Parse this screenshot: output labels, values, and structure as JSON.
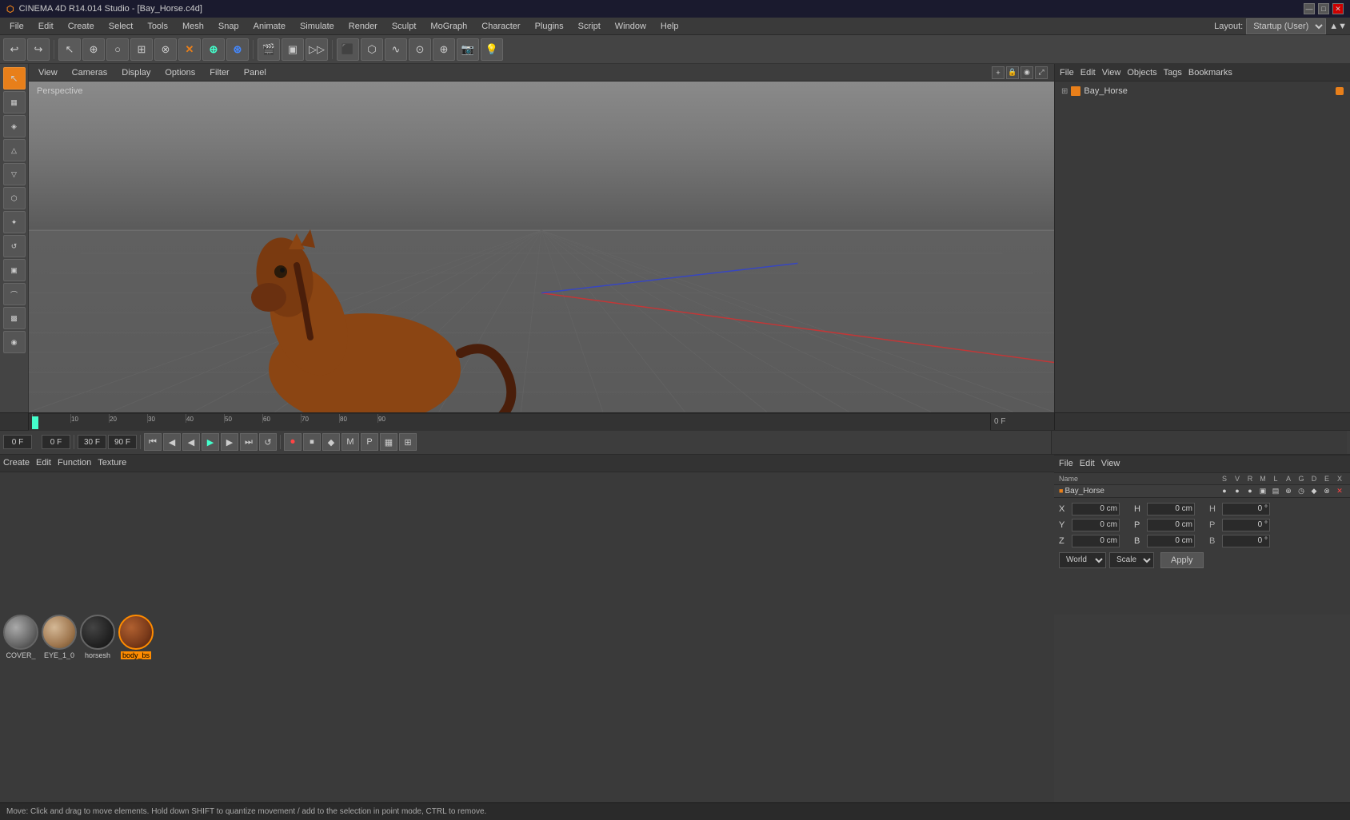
{
  "app": {
    "title": "CINEMA 4D R14.014 Studio - [Bay_Horse.c4d]",
    "icon": "C4D"
  },
  "title_controls": {
    "minimize": "—",
    "maximize": "□",
    "close": "✕"
  },
  "menu_bar": {
    "items": [
      "File",
      "Edit",
      "Create",
      "Select",
      "Tools",
      "Mesh",
      "Snap",
      "Animate",
      "Simulate",
      "Render",
      "Sculpt",
      "MoGraph",
      "Character",
      "Plugins",
      "Script",
      "Window",
      "Help"
    ]
  },
  "toolbar": {
    "layout_label": "Layout:",
    "layout_value": "Startup (User)",
    "buttons": [
      "↩",
      "↪",
      "↖",
      "+",
      "○",
      "⬡",
      "⊗",
      "⊕",
      "⊛",
      "◫",
      "▸",
      "⊞",
      "≡",
      "≋",
      "≣",
      "⬛",
      "⬡",
      "⊙",
      "⊕",
      "★",
      "☀"
    ]
  },
  "left_toolbar": {
    "buttons": [
      {
        "icon": "▷",
        "name": "move-tool",
        "active": true
      },
      {
        "icon": "⊞",
        "name": "grid-tool",
        "active": false
      },
      {
        "icon": "◈",
        "name": "polygon-tool",
        "active": false
      },
      {
        "icon": "△",
        "name": "model-tool",
        "active": false
      },
      {
        "icon": "▽",
        "name": "sculpt-tool",
        "active": false
      },
      {
        "icon": "⬡",
        "name": "object-tool",
        "active": false
      },
      {
        "icon": "↖",
        "name": "select-tool",
        "active": false
      },
      {
        "icon": "↺",
        "name": "rotate-tool",
        "active": false
      },
      {
        "icon": "⊞",
        "name": "uv-tool",
        "active": false
      },
      {
        "icon": "✦",
        "name": "star-tool",
        "active": false
      },
      {
        "icon": "⬛",
        "name": "texture-tool",
        "active": false
      },
      {
        "icon": "◉",
        "name": "brush-tool",
        "active": false
      }
    ]
  },
  "viewport": {
    "view_label": "Perspective",
    "menu_items": [
      "View",
      "Cameras",
      "Display",
      "Options",
      "Filter",
      "Panel"
    ]
  },
  "timeline": {
    "marks": [
      0,
      10,
      20,
      30,
      40,
      50,
      60,
      70,
      80,
      90
    ],
    "current_frame": "0 F",
    "end_frame": "90 F",
    "fps": "30 F",
    "frame_field_value": "0 F",
    "playhead_pos": 0
  },
  "transport": {
    "frame_start": "0 F",
    "frame_current": "0 F",
    "fps_value": "30 F",
    "end_frame": "90 F",
    "buttons": [
      "⏮",
      "◀◀",
      "◀",
      "▶",
      "▶▶",
      "⏭",
      "⏺"
    ]
  },
  "right_panel_top": {
    "menu_items": [
      "File",
      "Edit",
      "View",
      "Objects",
      "Tags",
      "Bookmarks"
    ],
    "object_name": "Bay_Horse",
    "object_icon_color": "#e87f1a"
  },
  "right_panel_bottom": {
    "menu_items": [
      "File",
      "Edit",
      "View"
    ],
    "columns": [
      "Name",
      "S",
      "V",
      "R",
      "M",
      "L",
      "A",
      "G",
      "D",
      "E",
      "X"
    ],
    "object_name": "Bay_Horse",
    "coords": {
      "x_pos": "0 cm",
      "y_pos": "0 cm",
      "z_pos": "0 cm",
      "x_size": "0 cm",
      "y_size": "0 cm",
      "z_size": "0 cm",
      "h_angle": "0 °",
      "p_angle": "0 °",
      "b_angle": "0 °"
    },
    "dropdown_world": "World",
    "dropdown_scale": "Scale",
    "apply_button": "Apply"
  },
  "materials": {
    "menu_items": [
      "Create",
      "Edit",
      "Function",
      "Texture"
    ],
    "items": [
      {
        "name": "COVER_",
        "color": "#808080",
        "selected": false
      },
      {
        "name": "EYE_1_0",
        "color": "#c8a882",
        "selected": false
      },
      {
        "name": "horsesh",
        "color": "#1a1a1a",
        "selected": false
      },
      {
        "name": "body_bs",
        "color": "#7a3a1a",
        "selected": true
      }
    ]
  },
  "status_bar": {
    "text": "Move: Click and drag to move elements. Hold down SHIFT to quantize movement / add to the selection in point mode, CTRL to remove."
  },
  "coord_labels": {
    "x": "X",
    "y": "Y",
    "z": "Z",
    "h": "H",
    "p": "P",
    "b": "B"
  }
}
